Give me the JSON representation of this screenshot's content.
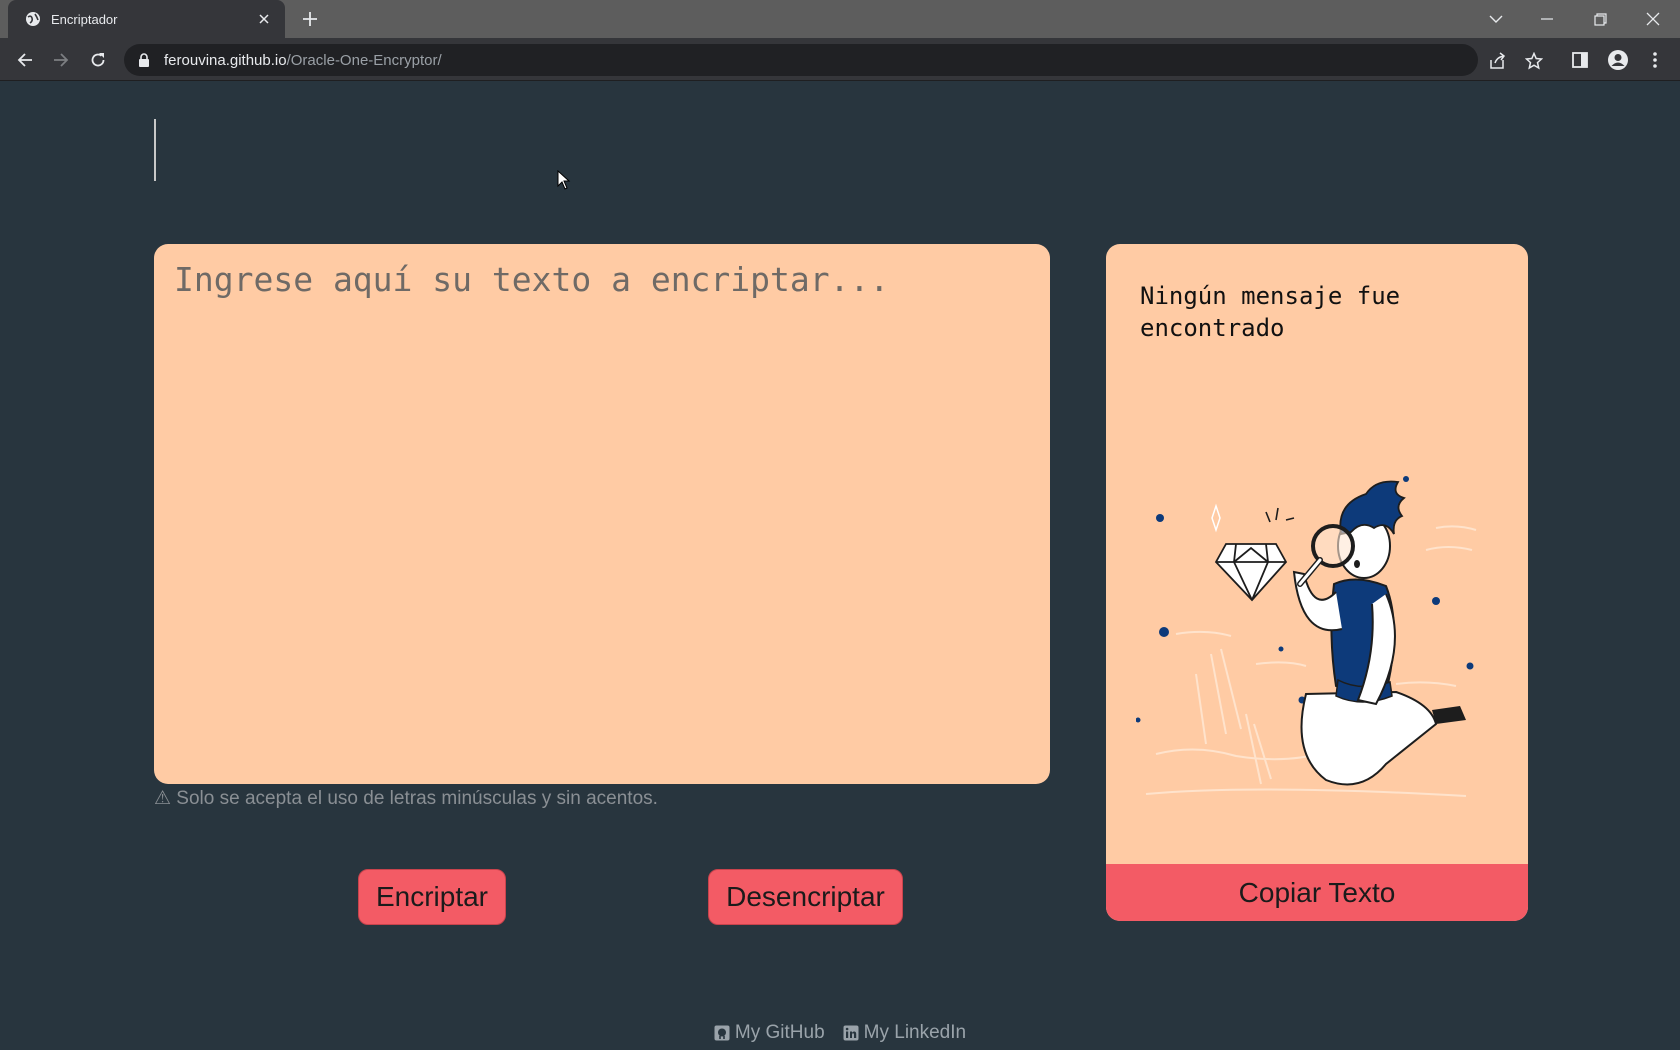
{
  "browser": {
    "tab_title": "Encriptador",
    "url_host": "ferouvina.github.io",
    "url_path": "/Oracle-One-Encryptor/"
  },
  "main": {
    "input_placeholder": "Ingrese aquí su texto a encriptar...",
    "warning": "⚠ Solo se acepta el uso de letras minúsculas y sin acentos.",
    "encrypt_label": "Encriptar",
    "decrypt_label": "Desencriptar"
  },
  "output": {
    "message": "Ningún mensaje fue encontrado",
    "copy_label": "Copiar Texto"
  },
  "footer": {
    "github_label": "My GitHub",
    "linkedin_label": "My LinkedIn"
  },
  "colors": {
    "background": "#28353e",
    "panel": "#ffcba4",
    "button": "#f35b65",
    "illustration_accent": "#0d3a7a"
  }
}
